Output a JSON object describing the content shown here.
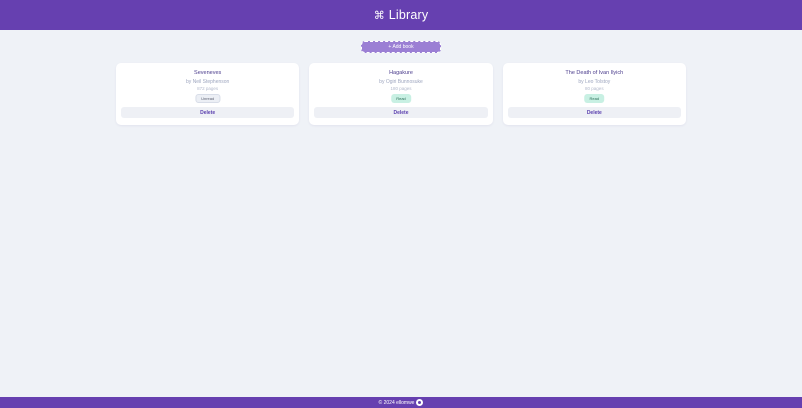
{
  "header": {
    "logo_icon": "book-grid-icon",
    "logo_glyph": "⌘",
    "title": "Library"
  },
  "toolbar": {
    "add_label": "+ Add book"
  },
  "books": [
    {
      "title": "Seveneves",
      "author": "by Neil Stephenson",
      "pages": "872 pages",
      "status": "Unread",
      "status_kind": "unread",
      "delete_label": "Delete"
    },
    {
      "title": "Hagakure",
      "author": "by Ogiri Bunnosuke",
      "pages": "180 pages",
      "status": "Read",
      "status_kind": "read",
      "delete_label": "Delete"
    },
    {
      "title": "The Death of Ivan Ilyich",
      "author": "by Leo Tolstoy",
      "pages": "80 pages",
      "status": "Read",
      "status_kind": "read",
      "delete_label": "Delete"
    }
  ],
  "footer": {
    "copyright": "© 2024 ellomwe",
    "icon": "github-icon"
  },
  "colors": {
    "primary": "#6640b0",
    "background": "#eff2f7",
    "read_badge": "#c8f0e3"
  }
}
